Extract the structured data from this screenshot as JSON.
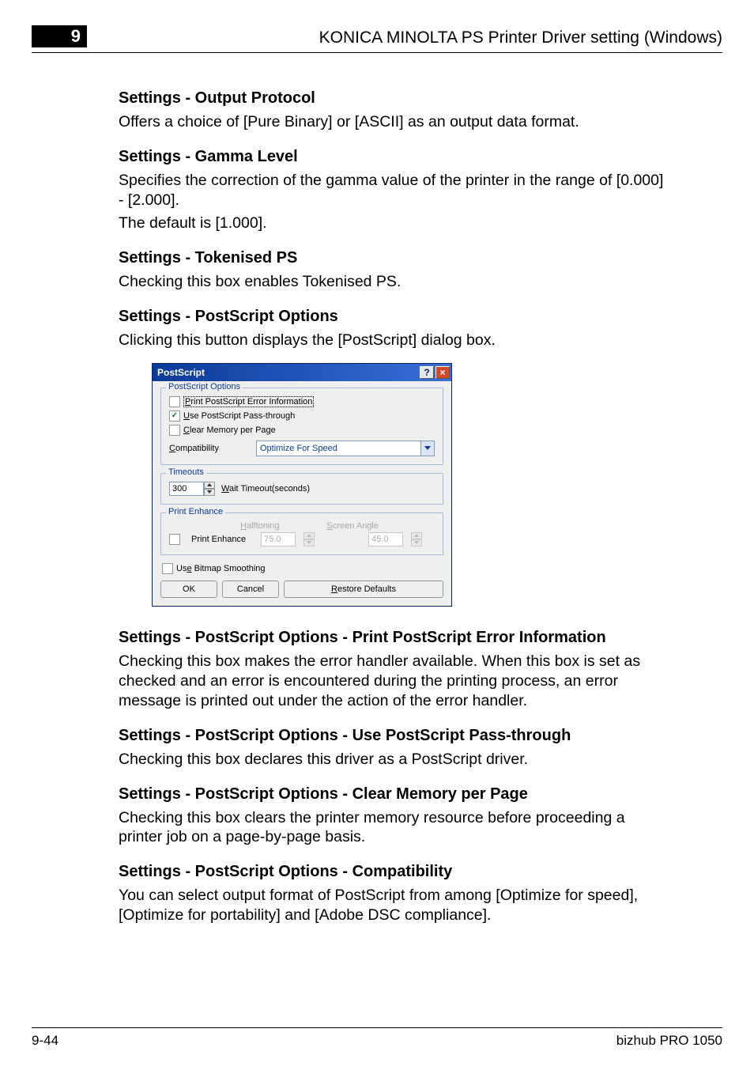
{
  "header": {
    "chapter": "9",
    "title": "KONICA MINOLTA PS Printer Driver setting (Windows)"
  },
  "sections": [
    {
      "heading": "Settings - Output Protocol",
      "paragraphs": [
        "Offers a choice of [Pure Binary] or [ASCII] as an output data format."
      ]
    },
    {
      "heading": "Settings - Gamma Level",
      "paragraphs": [
        "Specifies the correction of the gamma value of the printer in the range of [0.000] - [2.000].",
        "The default is [1.000]."
      ]
    },
    {
      "heading": "Settings - Tokenised PS",
      "paragraphs": [
        "Checking this box enables Tokenised PS."
      ]
    },
    {
      "heading": "Settings - PostScript Options",
      "paragraphs": [
        "Clicking this button displays the [PostScript] dialog box."
      ]
    }
  ],
  "dialog": {
    "title": "PostScript",
    "groups": {
      "options": {
        "legend": "PostScript Options",
        "print_error": {
          "label_before": "P",
          "label_after": "rint PostScript Error Information",
          "checked": false
        },
        "pass_through": {
          "label_before": "U",
          "label_after": "se PostScript Pass-through",
          "checked": true
        },
        "clear_memory": {
          "label_before": "C",
          "label_after": "lear Memory per Page",
          "checked": false
        },
        "compatibility_label_before": "C",
        "compatibility_label_after": "ompatibility",
        "compatibility_value": "Optimize For Speed"
      },
      "timeouts": {
        "legend": "Timeouts",
        "wait_value": "300",
        "wait_label_before": "W",
        "wait_label_after": "ait Timeout(seconds)"
      },
      "print_enhance": {
        "legend": "Print Enhance",
        "halftoning_before": "H",
        "halftoning_after": "alftoning",
        "screen_angle_before": "S",
        "screen_angle_after": "creen Angle",
        "print_enhance_before": "P",
        "print_enhance_after": "rint Enhance",
        "halftoning_value": "75.0",
        "screen_angle_value": "45.0",
        "print_enhance_checked": false
      },
      "bitmap_smoothing": {
        "label_before": "Us",
        "label_u": "e",
        "label_after": " Bitmap Smoothing",
        "checked": false
      }
    },
    "buttons": {
      "ok": "OK",
      "cancel": "Cancel",
      "restore_before": "R",
      "restore_after": "estore Defaults"
    }
  },
  "post_sections": [
    {
      "heading": "Settings - PostScript Options - Print PostScript Error Information",
      "paragraphs": [
        "Checking this box makes the error handler available. When this box is set as checked and an error is encountered during the printing process, an error message is printed out under the action of the error handler."
      ]
    },
    {
      "heading": "Settings - PostScript Options - Use PostScript Pass-through",
      "paragraphs": [
        "Checking this box declares this driver as a PostScript driver."
      ]
    },
    {
      "heading": "Settings - PostScript Options - Clear Memory per Page",
      "paragraphs": [
        "Checking this box clears the printer memory resource before proceeding a printer job on a page-by-page basis."
      ]
    },
    {
      "heading": "Settings - PostScript Options - Compatibility",
      "paragraphs": [
        "You can select output format of PostScript from among [Optimize for speed], [Optimize for portability] and  [Adobe DSC compliance]."
      ]
    }
  ],
  "footer": {
    "page": "9-44",
    "product": "bizhub PRO 1050"
  }
}
